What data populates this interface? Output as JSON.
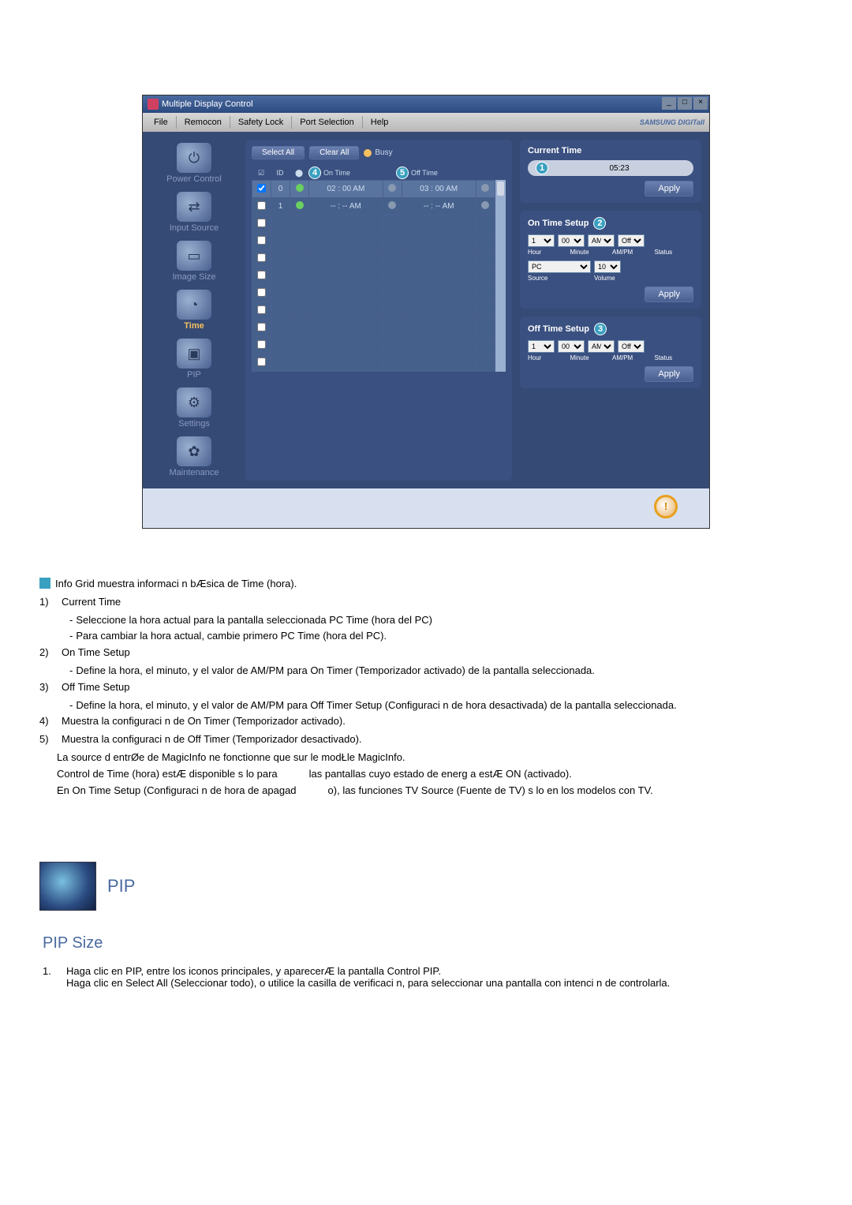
{
  "window": {
    "title": "Multiple Display Control",
    "menu": [
      "File",
      "Remocon",
      "Safety Lock",
      "Port Selection",
      "Help"
    ],
    "brand": "SAMSUNG DIGITall"
  },
  "sidebar": [
    {
      "label": "Power Control",
      "glyph": "⏻"
    },
    {
      "label": "Input Source",
      "glyph": "⇄"
    },
    {
      "label": "Image Size",
      "glyph": "▭"
    },
    {
      "label": "Time",
      "glyph": "◔"
    },
    {
      "label": "PIP",
      "glyph": "▣"
    },
    {
      "label": "Settings",
      "glyph": "⚙"
    },
    {
      "label": "Maintenance",
      "glyph": "✿"
    }
  ],
  "panel": {
    "select_all": "Select All",
    "clear_all": "Clear All",
    "busy": "Busy",
    "cols": {
      "id": "ID",
      "on_time": "On Time",
      "off_time": "Off Time"
    },
    "badge4": "4",
    "badge5": "5",
    "rows": [
      {
        "id": "0",
        "on": "02 : 00 AM",
        "off": "03 : 00 AM",
        "checked": true,
        "active": true
      },
      {
        "id": "1",
        "on": "-- : -- AM",
        "off": "-- : -- AM",
        "checked": false,
        "active": true
      }
    ]
  },
  "current_time": {
    "title": "Current Time",
    "badge": "1",
    "value": "05:23",
    "apply": "Apply"
  },
  "on_time": {
    "title": "On Time Setup",
    "badge": "2",
    "hour": "1",
    "minute": "00",
    "ampm": "AM",
    "status": "Off",
    "row1labels": [
      "Hour",
      "Minute",
      "AM/PM",
      "Status"
    ],
    "source": "PC",
    "volume": "10",
    "row2labels": [
      "Source",
      "Volume"
    ],
    "apply": "Apply"
  },
  "off_time": {
    "title": "Off Time Setup",
    "badge": "3",
    "hour": "1",
    "minute": "00",
    "ampm": "AM",
    "status": "Off",
    "labels": [
      "Hour",
      "Minute",
      "AM/PM",
      "Status"
    ],
    "apply": "Apply"
  },
  "footer_mark": "!",
  "doc": {
    "intro": "Info Grid muestra informaci n bÆsica de Time (hora).",
    "item1_num": "1)",
    "item1": "Current Time",
    "item1_a": "Seleccione la hora actual para la pantalla seleccionada PC Time (hora del PC)",
    "item1_b": "Para cambiar la hora actual, cambie primero PC Time (hora del PC).",
    "item2_num": "2)",
    "item2": "On Time Setup",
    "item2_a": "Define la hora, el minuto, y el valor  de AM/PM para On Timer (Temporizador activado) de la pantalla seleccionada.",
    "item3_num": "3)",
    "item3": "Off Time Setup",
    "item3_a": "Define la hora, el minuto, y el valor de AM/PM para Off  Timer Setup (Configuraci n de hora desactivada) de la pantalla seleccionada.",
    "item4_num": "4)",
    "item4": "Muestra la configuraci n de On  Timer (Temporizador activado).",
    "item5_num": "5)",
    "item5": "Muestra la configuraci n de Off Timer (Temporizador desactivado).",
    "note1": "La source d entrØe de MagicInfo ne fonctionne que sur le modŁle MagicInfo.",
    "note2a": "Control de Time (hora) estÆ disponible s lo para",
    "note2b": "las pantallas cuyo estado de energ a estÆ ON (activado).",
    "note3a": "En On Time Setup (Configuraci n de hora de apagad",
    "note3b": "o), las funciones TV Source (Fuente de TV) s lo en los modelos con TV."
  },
  "pip": {
    "heading": "PIP",
    "subtitle": "PIP Size",
    "list_num": "1.",
    "p1": "Haga clic en PIP, entre los iconos principales, y aparecerÆ la pantalla Control PIP.",
    "p2": "Haga clic en Select All (Seleccionar todo), o utilice la casilla de verificaci n, para seleccionar una pantalla con intenci n de controlarla."
  }
}
